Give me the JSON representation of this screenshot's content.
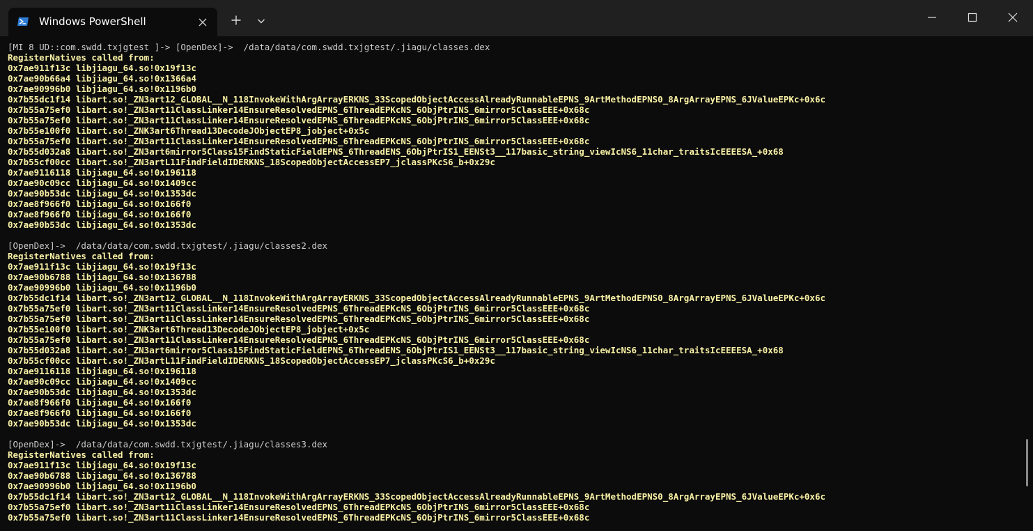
{
  "window": {
    "tab_title": "Windows PowerShell",
    "tab_icon": "powershell-icon",
    "controls": [
      "new-tab-icon",
      "dropdown-icon",
      "minimize-icon",
      "maximize-icon",
      "close-icon"
    ]
  },
  "colors": {
    "background": "#0c0c0c",
    "titlebar": "#202020",
    "prompt_text": "#cccccc",
    "output_text": "#f9f1a5"
  },
  "terminal": {
    "lines": [
      {
        "kind": "prompt",
        "text": "[MI 8 UD::com.swdd.txjgtest ]-> [OpenDex]->  /data/data/com.swdd.txjgtest/.jiagu/classes.dex"
      },
      {
        "kind": "out",
        "text": "RegisterNatives called from:"
      },
      {
        "kind": "out",
        "text": "0x7ae911f13c libjiagu_64.so!0x19f13c"
      },
      {
        "kind": "out",
        "text": "0x7ae90b66a4 libjiagu_64.so!0x1366a4"
      },
      {
        "kind": "out",
        "text": "0x7ae90996b0 libjiagu_64.so!0x1196b0"
      },
      {
        "kind": "out",
        "text": "0x7b55dc1f14 libart.so!_ZN3art12_GLOBAL__N_118InvokeWithArgArrayERKNS_33ScopedObjectAccessAlreadyRunnableEPNS_9ArtMethodEPNS0_8ArgArrayEPNS_6JValueEPKc+0x6c"
      },
      {
        "kind": "out",
        "text": "0x7b55a75ef0 libart.so!_ZN3art11ClassLinker14EnsureResolvedEPNS_6ThreadEPKcNS_6ObjPtrINS_6mirror5ClassEEE+0x68c"
      },
      {
        "kind": "out",
        "text": "0x7b55a75ef0 libart.so!_ZN3art11ClassLinker14EnsureResolvedEPNS_6ThreadEPKcNS_6ObjPtrINS_6mirror5ClassEEE+0x68c"
      },
      {
        "kind": "out",
        "text": "0x7b55e100f0 libart.so!_ZNK3art6Thread13DecodeJObjectEP8_jobject+0x5c"
      },
      {
        "kind": "out",
        "text": "0x7b55a75ef0 libart.so!_ZN3art11ClassLinker14EnsureResolvedEPNS_6ThreadEPKcNS_6ObjPtrINS_6mirror5ClassEEE+0x68c"
      },
      {
        "kind": "out",
        "text": "0x7b55d032a8 libart.so!_ZN3art6mirror5Class15FindStaticFieldEPNS_6ThreadENS_6ObjPtrIS1_EENSt3__117basic_string_viewIcNS6_11char_traitsIcEEEESA_+0x68"
      },
      {
        "kind": "out",
        "text": "0x7b55cf00cc libart.so!_ZN3artL11FindFieldIDERKNS_18ScopedObjectAccessEP7_jclassPKcS6_b+0x29c"
      },
      {
        "kind": "out",
        "text": "0x7ae9116118 libjiagu_64.so!0x196118"
      },
      {
        "kind": "out",
        "text": "0x7ae90c09cc libjiagu_64.so!0x1409cc"
      },
      {
        "kind": "out",
        "text": "0x7ae90b53dc libjiagu_64.so!0x1353dc"
      },
      {
        "kind": "out",
        "text": "0x7ae8f966f0 libjiagu_64.so!0x166f0"
      },
      {
        "kind": "out",
        "text": "0x7ae8f966f0 libjiagu_64.so!0x166f0"
      },
      {
        "kind": "out",
        "text": "0x7ae90b53dc libjiagu_64.so!0x1353dc"
      },
      {
        "kind": "blank",
        "text": ""
      },
      {
        "kind": "prompt",
        "text": "[OpenDex]->  /data/data/com.swdd.txjgtest/.jiagu/classes2.dex"
      },
      {
        "kind": "out",
        "text": "RegisterNatives called from:"
      },
      {
        "kind": "out",
        "text": "0x7ae911f13c libjiagu_64.so!0x19f13c"
      },
      {
        "kind": "out",
        "text": "0x7ae90b6788 libjiagu_64.so!0x136788"
      },
      {
        "kind": "out",
        "text": "0x7ae90996b0 libjiagu_64.so!0x1196b0"
      },
      {
        "kind": "out",
        "text": "0x7b55dc1f14 libart.so!_ZN3art12_GLOBAL__N_118InvokeWithArgArrayERKNS_33ScopedObjectAccessAlreadyRunnableEPNS_9ArtMethodEPNS0_8ArgArrayEPNS_6JValueEPKc+0x6c"
      },
      {
        "kind": "out",
        "text": "0x7b55a75ef0 libart.so!_ZN3art11ClassLinker14EnsureResolvedEPNS_6ThreadEPKcNS_6ObjPtrINS_6mirror5ClassEEE+0x68c"
      },
      {
        "kind": "out",
        "text": "0x7b55a75ef0 libart.so!_ZN3art11ClassLinker14EnsureResolvedEPNS_6ThreadEPKcNS_6ObjPtrINS_6mirror5ClassEEE+0x68c"
      },
      {
        "kind": "out",
        "text": "0x7b55e100f0 libart.so!_ZNK3art6Thread13DecodeJObjectEP8_jobject+0x5c"
      },
      {
        "kind": "out",
        "text": "0x7b55a75ef0 libart.so!_ZN3art11ClassLinker14EnsureResolvedEPNS_6ThreadEPKcNS_6ObjPtrINS_6mirror5ClassEEE+0x68c"
      },
      {
        "kind": "out",
        "text": "0x7b55d032a8 libart.so!_ZN3art6mirror5Class15FindStaticFieldEPNS_6ThreadENS_6ObjPtrIS1_EENSt3__117basic_string_viewIcNS6_11char_traitsIcEEEESA_+0x68"
      },
      {
        "kind": "out",
        "text": "0x7b55cf00cc libart.so!_ZN3artL11FindFieldIDERKNS_18ScopedObjectAccessEP7_jclassPKcS6_b+0x29c"
      },
      {
        "kind": "out",
        "text": "0x7ae9116118 libjiagu_64.so!0x196118"
      },
      {
        "kind": "out",
        "text": "0x7ae90c09cc libjiagu_64.so!0x1409cc"
      },
      {
        "kind": "out",
        "text": "0x7ae90b53dc libjiagu_64.so!0x1353dc"
      },
      {
        "kind": "out",
        "text": "0x7ae8f966f0 libjiagu_64.so!0x166f0"
      },
      {
        "kind": "out",
        "text": "0x7ae8f966f0 libjiagu_64.so!0x166f0"
      },
      {
        "kind": "out",
        "text": "0x7ae90b53dc libjiagu_64.so!0x1353dc"
      },
      {
        "kind": "blank",
        "text": ""
      },
      {
        "kind": "prompt",
        "text": "[OpenDex]->  /data/data/com.swdd.txjgtest/.jiagu/classes3.dex"
      },
      {
        "kind": "out",
        "text": "RegisterNatives called from:"
      },
      {
        "kind": "out",
        "text": "0x7ae911f13c libjiagu_64.so!0x19f13c"
      },
      {
        "kind": "out",
        "text": "0x7ae90b6788 libjiagu_64.so!0x136788"
      },
      {
        "kind": "out",
        "text": "0x7ae90996b0 libjiagu_64.so!0x1196b0"
      },
      {
        "kind": "out",
        "text": "0x7b55dc1f14 libart.so!_ZN3art12_GLOBAL__N_118InvokeWithArgArrayERKNS_33ScopedObjectAccessAlreadyRunnableEPNS_9ArtMethodEPNS0_8ArgArrayEPNS_6JValueEPKc+0x6c"
      },
      {
        "kind": "out",
        "text": "0x7b55a75ef0 libart.so!_ZN3art11ClassLinker14EnsureResolvedEPNS_6ThreadEPKcNS_6ObjPtrINS_6mirror5ClassEEE+0x68c"
      },
      {
        "kind": "out",
        "text": "0x7b55a75ef0 libart.so!_ZN3art11ClassLinker14EnsureResolvedEPNS_6ThreadEPKcNS_6ObjPtrINS_6mirror5ClassEEE+0x68c"
      }
    ]
  }
}
